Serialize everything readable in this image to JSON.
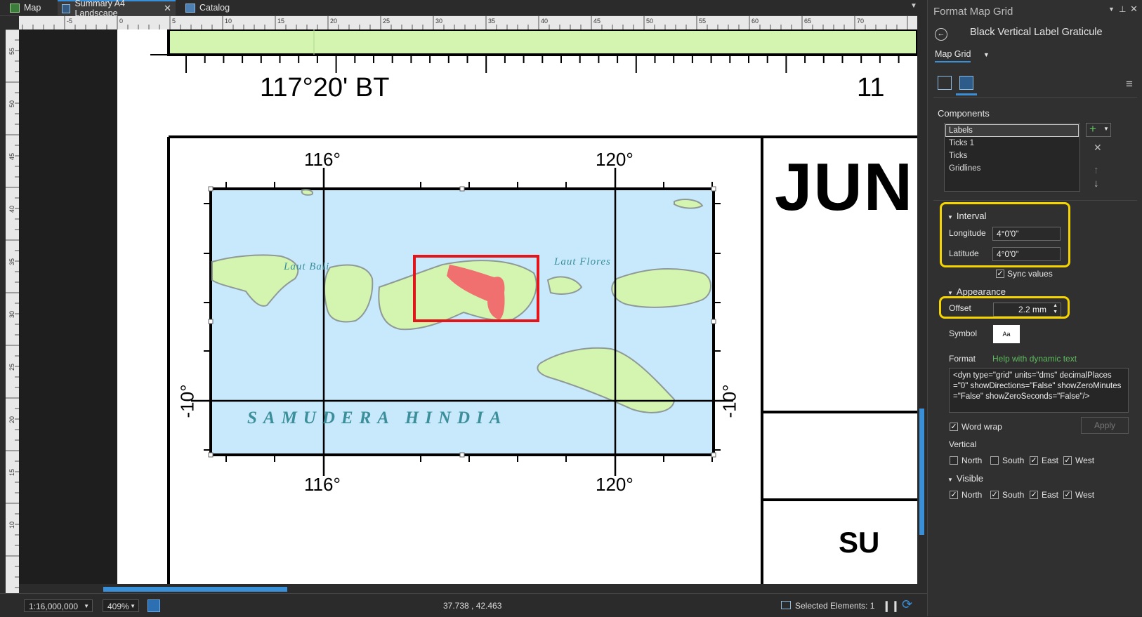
{
  "tabs": [
    {
      "label": "Map",
      "active": false
    },
    {
      "label": "Summary A4 Landscape",
      "active": true
    },
    {
      "label": "Catalog",
      "active": false
    }
  ],
  "ruler": {
    "h_ticks": [
      "-5",
      "0",
      "5",
      "10",
      "15",
      "20",
      "25",
      "30",
      "35",
      "40",
      "45",
      "50",
      "55",
      "60",
      "65",
      "70"
    ],
    "v_ticks": [
      "55",
      "50",
      "45",
      "40",
      "35",
      "30",
      "25",
      "20",
      "15",
      "10"
    ]
  },
  "layout": {
    "coord_top_label": "117°20' BT",
    "coord_top_label_cut": "11",
    "map_lon_labels": [
      "116°",
      "120°"
    ],
    "map_lat_label": "-10°",
    "place_labels": {
      "laut_bali": "Laut Bali",
      "laut_flores": "Laut Flores",
      "ocean": "SAMUDERA HINDIA"
    },
    "title_cut": "JUN",
    "subtitle_cut": "SU"
  },
  "status": {
    "scale": "1:16,000,000",
    "zoom": "409%",
    "coords": "37.738 , 42.463",
    "selected": "Selected Elements: 1"
  },
  "panel": {
    "title": "Format Map Grid",
    "element_name": "Black Vertical Label Graticule",
    "dropdown": "Map Grid",
    "components_heading": "Components",
    "components": [
      "Labels",
      "Ticks 1",
      "Ticks",
      "Gridlines"
    ],
    "selected_component": "Labels",
    "interval_heading": "Interval",
    "longitude_label": "Longitude",
    "longitude_value": "4°0'0\"",
    "latitude_label": "Latitude",
    "latitude_value": "4°0'0\"",
    "sync_label": "Sync values",
    "appearance_heading": "Appearance",
    "offset_label": "Offset",
    "offset_value": "2.2 mm",
    "symbol_label": "Symbol",
    "symbol_preview": "Aa",
    "format_label": "Format",
    "help_link": "Help with dynamic text",
    "format_text": "<dyn type=\"grid\" units=\"dms\" decimalPlaces=\"0\" showDirections=\"False\" showZeroMinutes=\"False\" showZeroSeconds=\"False\"/>",
    "word_wrap_label": "Word wrap",
    "apply_label": "Apply",
    "vertical_heading": "Vertical",
    "vertical_options": [
      {
        "label": "North",
        "checked": false
      },
      {
        "label": "South",
        "checked": false
      },
      {
        "label": "East",
        "checked": true
      },
      {
        "label": "West",
        "checked": true
      }
    ],
    "visible_heading": "Visible",
    "visible_options": [
      {
        "label": "North",
        "checked": true
      },
      {
        "label": "South",
        "checked": true
      },
      {
        "label": "East",
        "checked": true
      },
      {
        "label": "West",
        "checked": true
      }
    ]
  },
  "colors": {
    "highlight": "#f5d400",
    "accent": "#3a8fd9",
    "sea": "#c8e8fb",
    "land": "#d4f5b0",
    "selection_box": "#e0161b",
    "highlight_region": "#f07070",
    "label_water": "#3a8f9b"
  }
}
